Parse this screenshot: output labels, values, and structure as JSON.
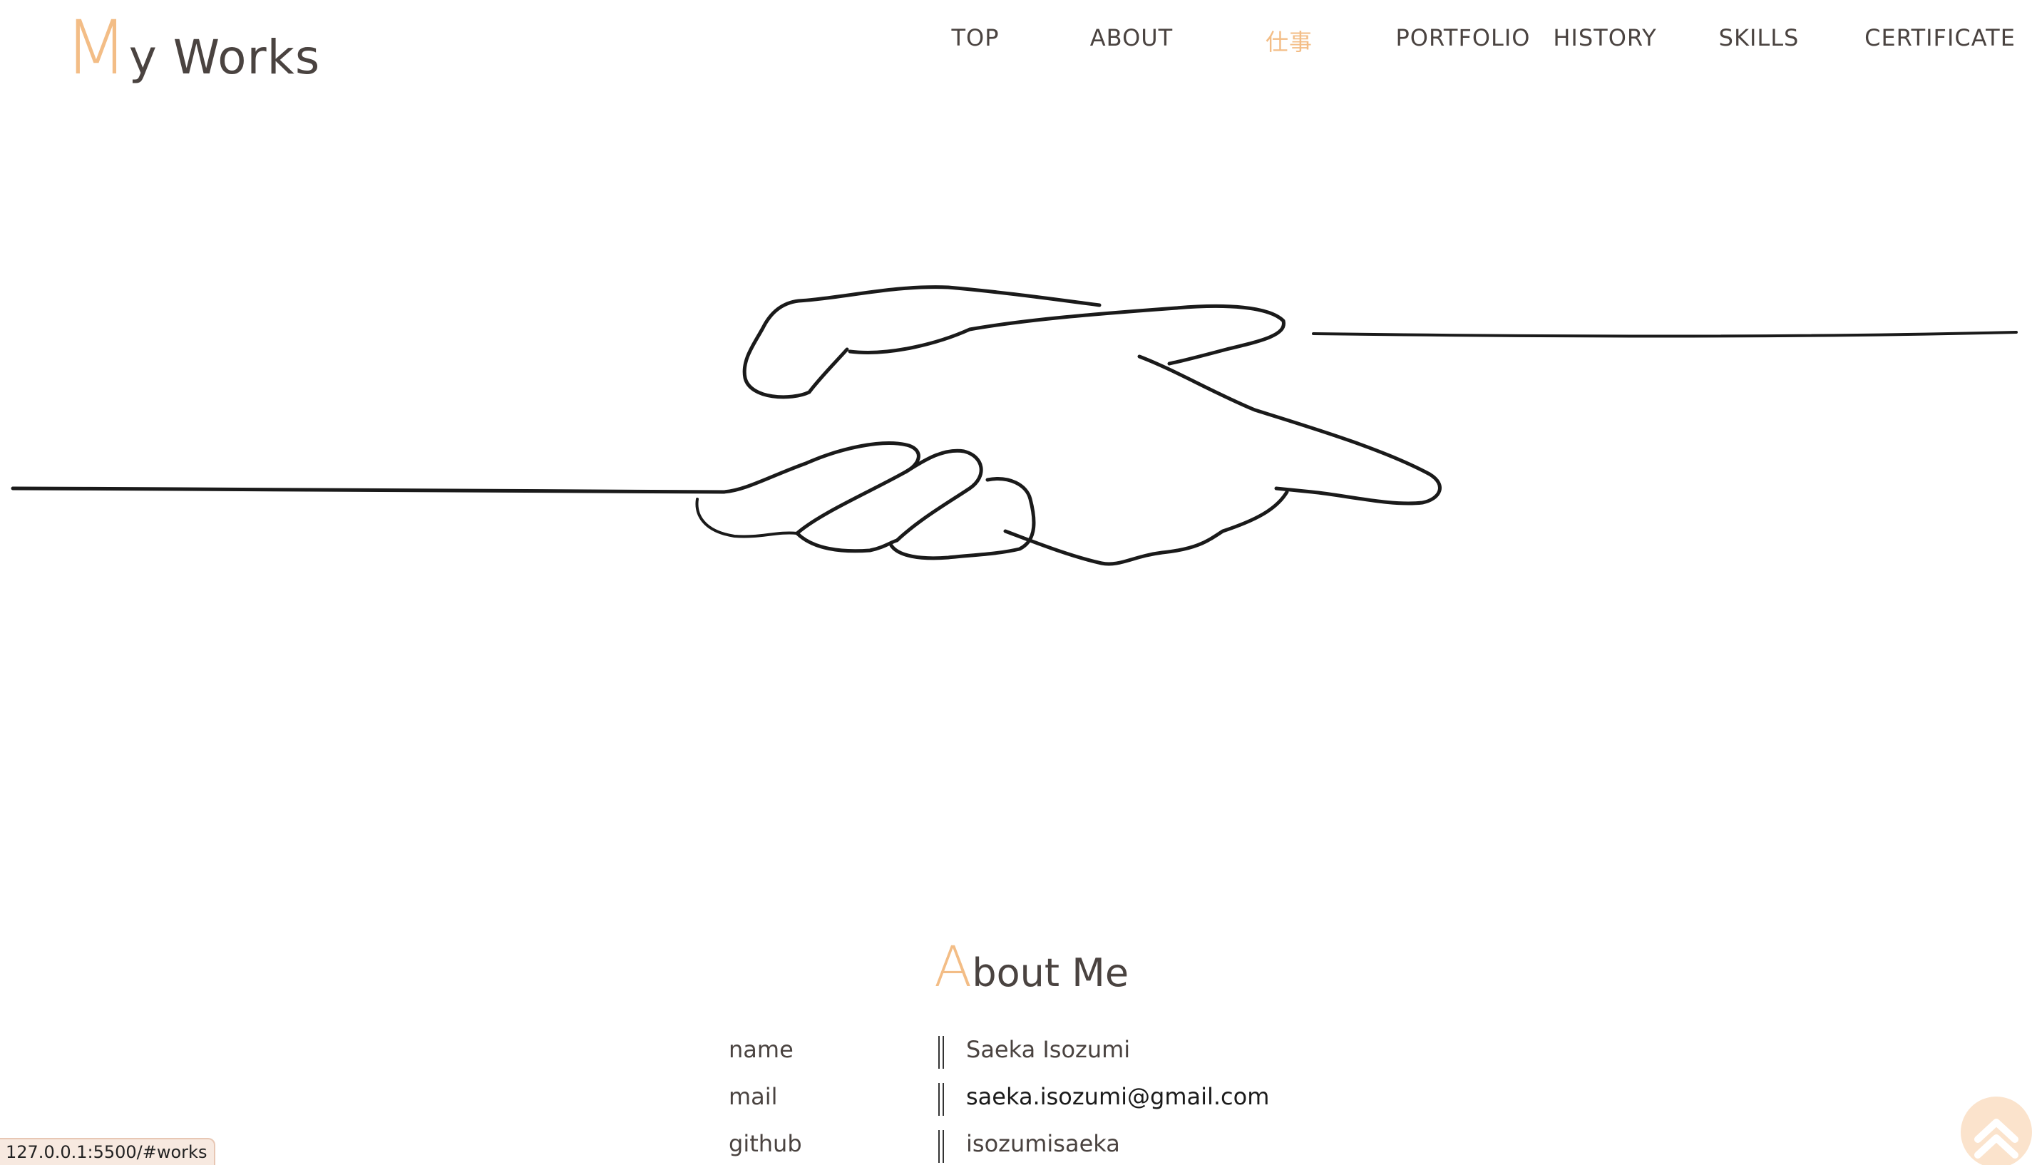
{
  "logo": {
    "initial": "M",
    "rest": "y Works"
  },
  "nav": {
    "items": [
      {
        "label": "TOP"
      },
      {
        "label": "ABOUT"
      },
      {
        "label": "仕事",
        "active": true
      },
      {
        "label": "PORTFOLIO"
      },
      {
        "label": "HISTORY"
      },
      {
        "label": "SKILLS"
      },
      {
        "label": "CERTIFICATE"
      }
    ]
  },
  "about": {
    "title_initial": "A",
    "title_rest": "bout Me",
    "rows": [
      {
        "label": "name",
        "value": "Saeka Isozumi"
      },
      {
        "label": "mail",
        "value": "saeka.isozumi@gmail.com"
      },
      {
        "label": "github",
        "value": "isozumisaeka"
      }
    ]
  },
  "status_bar": {
    "url": "127.0.0.1:5500/#works"
  },
  "colors": {
    "accent": "#f3bd86",
    "text": "#4a4340",
    "to_top_bg": "#fbe3cc"
  },
  "icons": {
    "to_top": "double-chevron-up-icon",
    "hero": "handshake-illustration"
  }
}
